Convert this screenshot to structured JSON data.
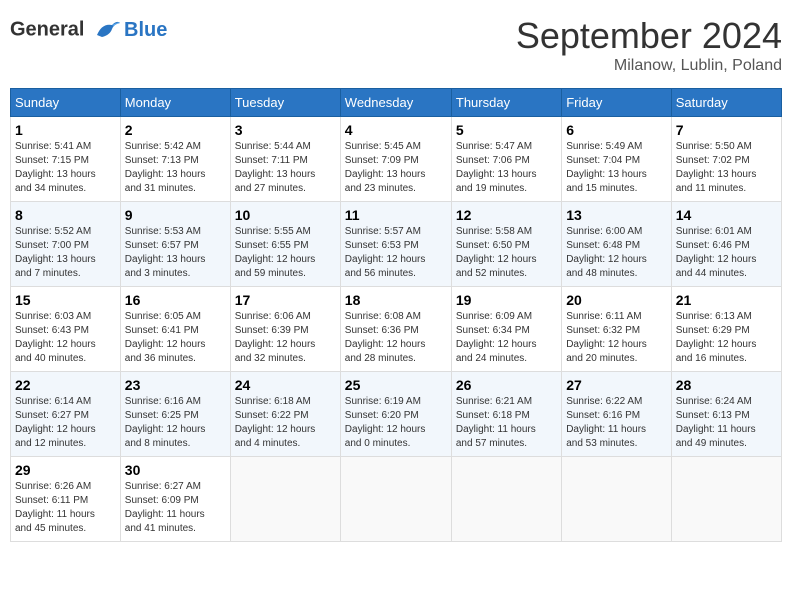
{
  "header": {
    "logo_line1": "General",
    "logo_line2": "Blue",
    "month": "September 2024",
    "location": "Milanow, Lublin, Poland"
  },
  "days_of_week": [
    "Sunday",
    "Monday",
    "Tuesday",
    "Wednesday",
    "Thursday",
    "Friday",
    "Saturday"
  ],
  "weeks": [
    [
      {
        "day": "1",
        "info": "Sunrise: 5:41 AM\nSunset: 7:15 PM\nDaylight: 13 hours\nand 34 minutes."
      },
      {
        "day": "2",
        "info": "Sunrise: 5:42 AM\nSunset: 7:13 PM\nDaylight: 13 hours\nand 31 minutes."
      },
      {
        "day": "3",
        "info": "Sunrise: 5:44 AM\nSunset: 7:11 PM\nDaylight: 13 hours\nand 27 minutes."
      },
      {
        "day": "4",
        "info": "Sunrise: 5:45 AM\nSunset: 7:09 PM\nDaylight: 13 hours\nand 23 minutes."
      },
      {
        "day": "5",
        "info": "Sunrise: 5:47 AM\nSunset: 7:06 PM\nDaylight: 13 hours\nand 19 minutes."
      },
      {
        "day": "6",
        "info": "Sunrise: 5:49 AM\nSunset: 7:04 PM\nDaylight: 13 hours\nand 15 minutes."
      },
      {
        "day": "7",
        "info": "Sunrise: 5:50 AM\nSunset: 7:02 PM\nDaylight: 13 hours\nand 11 minutes."
      }
    ],
    [
      {
        "day": "8",
        "info": "Sunrise: 5:52 AM\nSunset: 7:00 PM\nDaylight: 13 hours\nand 7 minutes."
      },
      {
        "day": "9",
        "info": "Sunrise: 5:53 AM\nSunset: 6:57 PM\nDaylight: 13 hours\nand 3 minutes."
      },
      {
        "day": "10",
        "info": "Sunrise: 5:55 AM\nSunset: 6:55 PM\nDaylight: 12 hours\nand 59 minutes."
      },
      {
        "day": "11",
        "info": "Sunrise: 5:57 AM\nSunset: 6:53 PM\nDaylight: 12 hours\nand 56 minutes."
      },
      {
        "day": "12",
        "info": "Sunrise: 5:58 AM\nSunset: 6:50 PM\nDaylight: 12 hours\nand 52 minutes."
      },
      {
        "day": "13",
        "info": "Sunrise: 6:00 AM\nSunset: 6:48 PM\nDaylight: 12 hours\nand 48 minutes."
      },
      {
        "day": "14",
        "info": "Sunrise: 6:01 AM\nSunset: 6:46 PM\nDaylight: 12 hours\nand 44 minutes."
      }
    ],
    [
      {
        "day": "15",
        "info": "Sunrise: 6:03 AM\nSunset: 6:43 PM\nDaylight: 12 hours\nand 40 minutes."
      },
      {
        "day": "16",
        "info": "Sunrise: 6:05 AM\nSunset: 6:41 PM\nDaylight: 12 hours\nand 36 minutes."
      },
      {
        "day": "17",
        "info": "Sunrise: 6:06 AM\nSunset: 6:39 PM\nDaylight: 12 hours\nand 32 minutes."
      },
      {
        "day": "18",
        "info": "Sunrise: 6:08 AM\nSunset: 6:36 PM\nDaylight: 12 hours\nand 28 minutes."
      },
      {
        "day": "19",
        "info": "Sunrise: 6:09 AM\nSunset: 6:34 PM\nDaylight: 12 hours\nand 24 minutes."
      },
      {
        "day": "20",
        "info": "Sunrise: 6:11 AM\nSunset: 6:32 PM\nDaylight: 12 hours\nand 20 minutes."
      },
      {
        "day": "21",
        "info": "Sunrise: 6:13 AM\nSunset: 6:29 PM\nDaylight: 12 hours\nand 16 minutes."
      }
    ],
    [
      {
        "day": "22",
        "info": "Sunrise: 6:14 AM\nSunset: 6:27 PM\nDaylight: 12 hours\nand 12 minutes."
      },
      {
        "day": "23",
        "info": "Sunrise: 6:16 AM\nSunset: 6:25 PM\nDaylight: 12 hours\nand 8 minutes."
      },
      {
        "day": "24",
        "info": "Sunrise: 6:18 AM\nSunset: 6:22 PM\nDaylight: 12 hours\nand 4 minutes."
      },
      {
        "day": "25",
        "info": "Sunrise: 6:19 AM\nSunset: 6:20 PM\nDaylight: 12 hours\nand 0 minutes."
      },
      {
        "day": "26",
        "info": "Sunrise: 6:21 AM\nSunset: 6:18 PM\nDaylight: 11 hours\nand 57 minutes."
      },
      {
        "day": "27",
        "info": "Sunrise: 6:22 AM\nSunset: 6:16 PM\nDaylight: 11 hours\nand 53 minutes."
      },
      {
        "day": "28",
        "info": "Sunrise: 6:24 AM\nSunset: 6:13 PM\nDaylight: 11 hours\nand 49 minutes."
      }
    ],
    [
      {
        "day": "29",
        "info": "Sunrise: 6:26 AM\nSunset: 6:11 PM\nDaylight: 11 hours\nand 45 minutes."
      },
      {
        "day": "30",
        "info": "Sunrise: 6:27 AM\nSunset: 6:09 PM\nDaylight: 11 hours\nand 41 minutes."
      },
      {
        "day": "",
        "info": ""
      },
      {
        "day": "",
        "info": ""
      },
      {
        "day": "",
        "info": ""
      },
      {
        "day": "",
        "info": ""
      },
      {
        "day": "",
        "info": ""
      }
    ]
  ]
}
